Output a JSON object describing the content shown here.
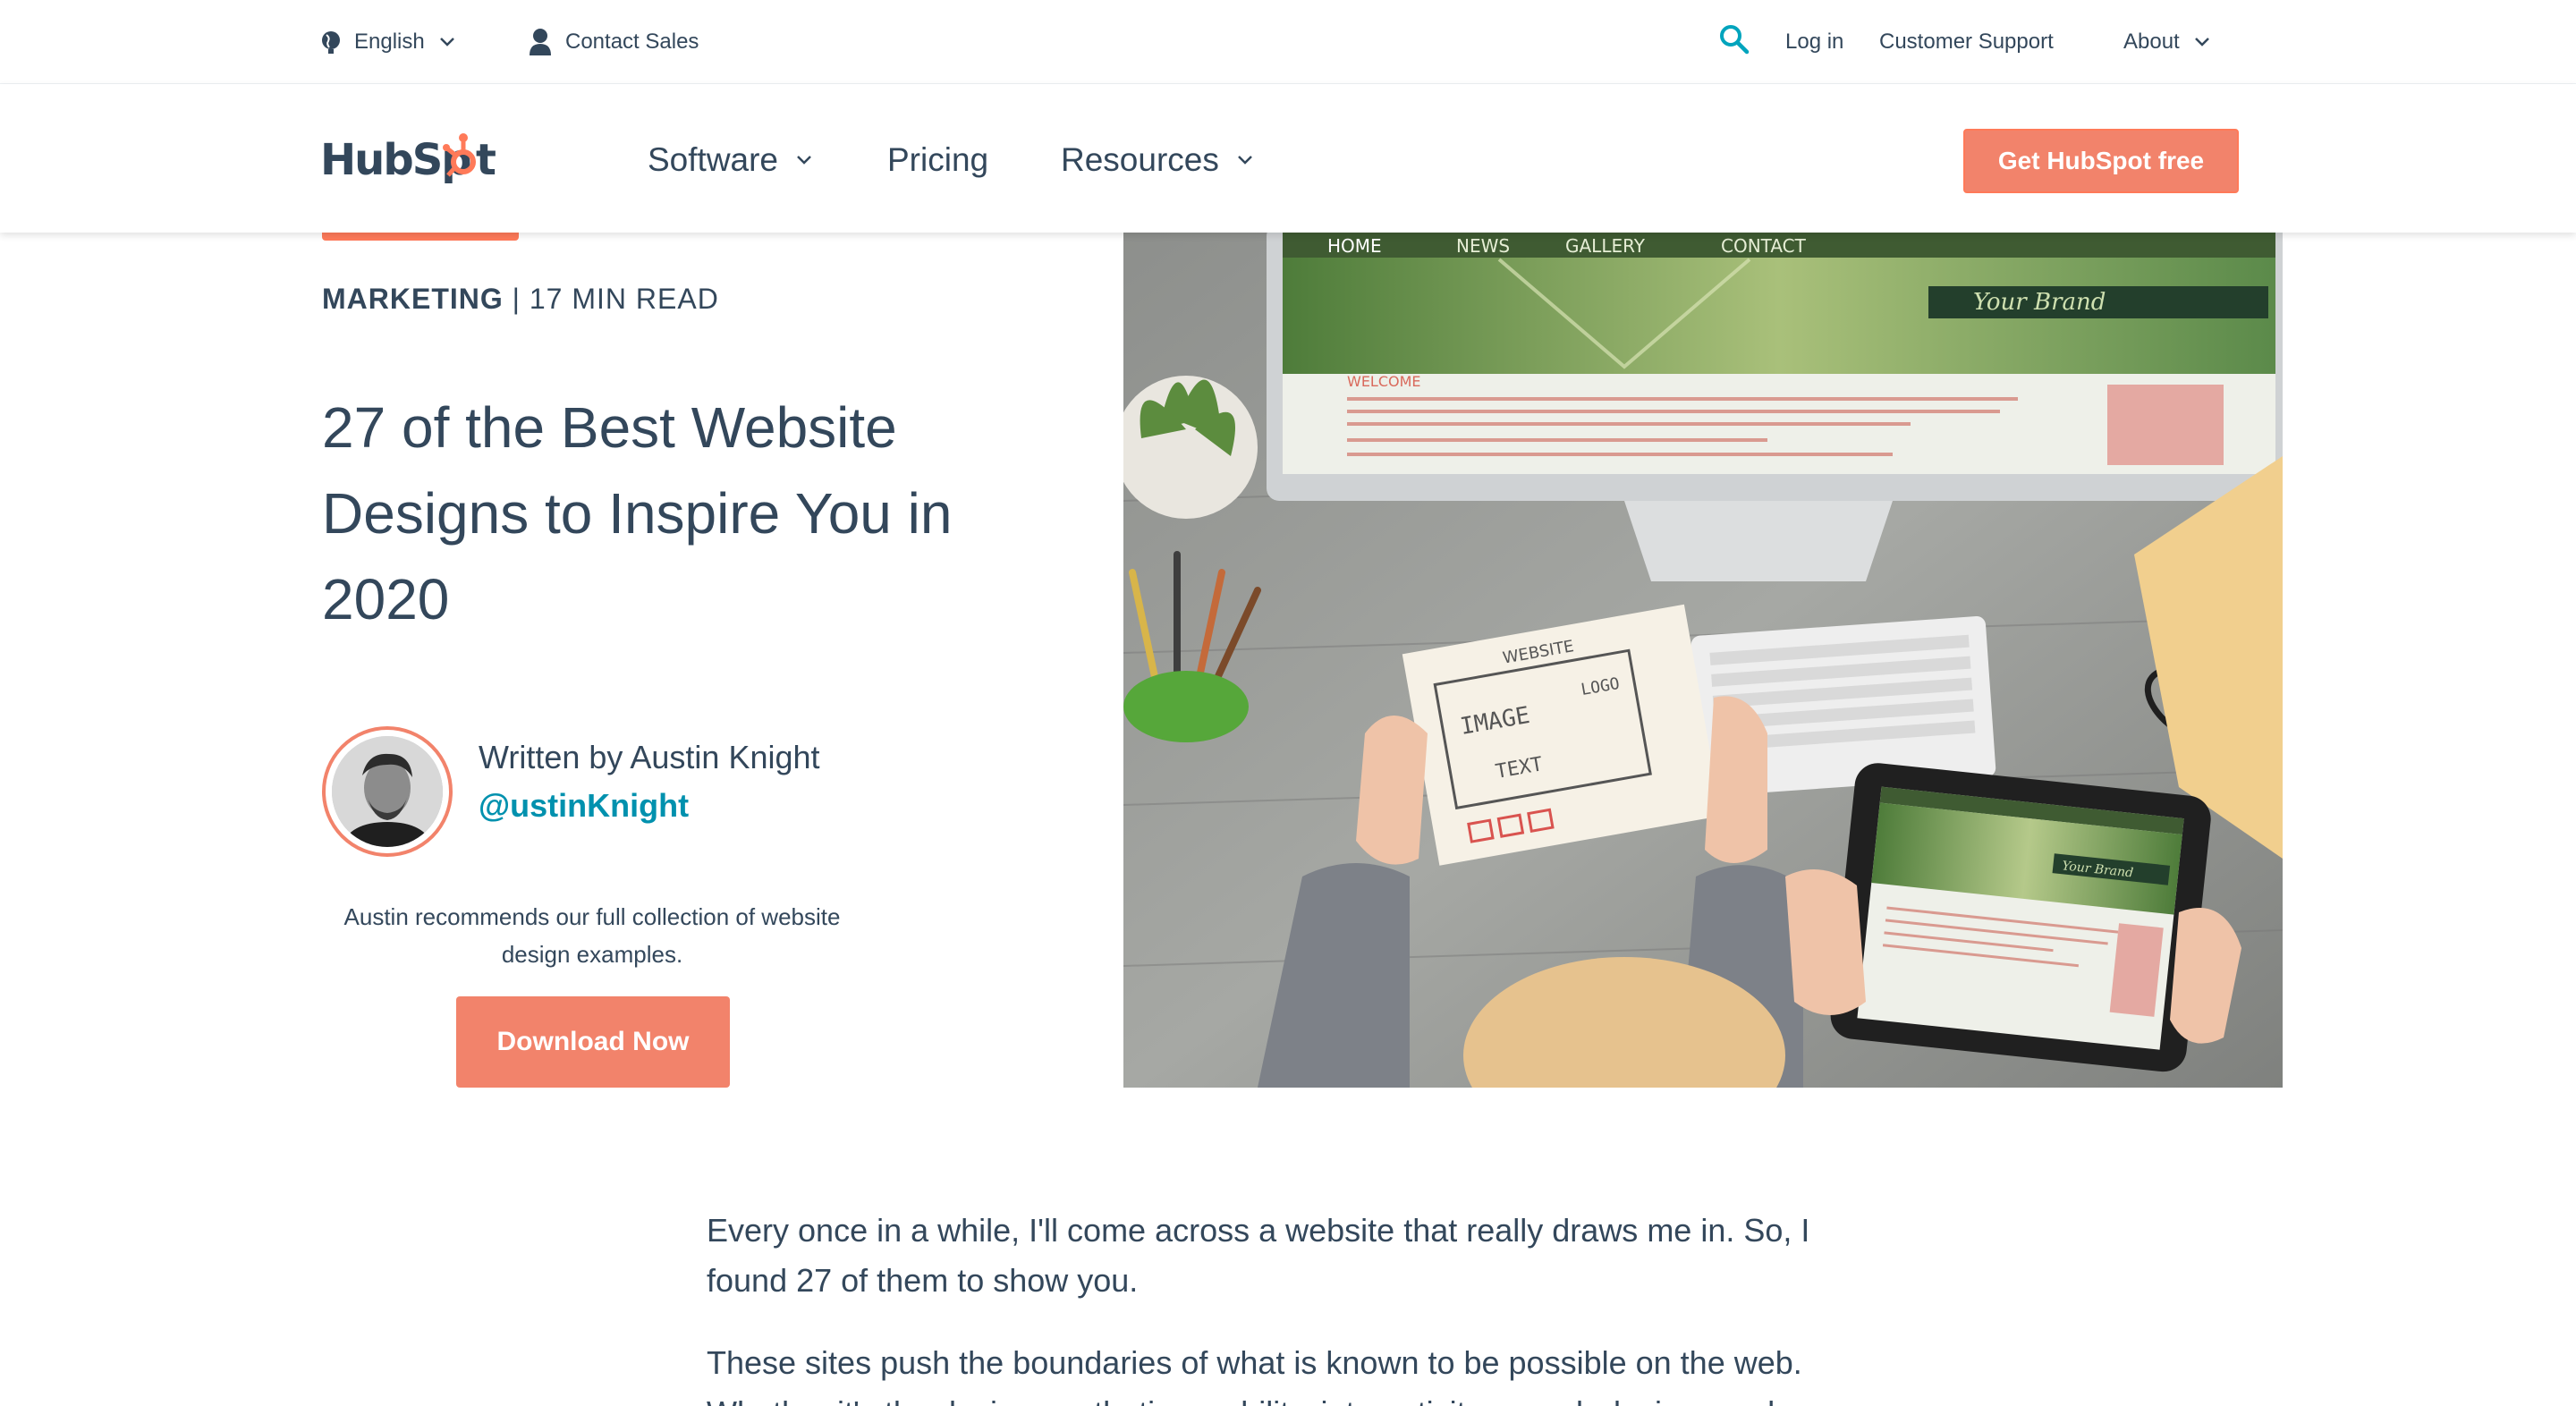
{
  "utility": {
    "language": "English",
    "contact_sales": "Contact Sales",
    "login": "Log in",
    "customer_support": "Customer Support",
    "about": "About"
  },
  "nav": {
    "logo": "HubSpot",
    "software": "Software",
    "pricing": "Pricing",
    "resources": "Resources",
    "cta": "Get HubSpot free"
  },
  "article": {
    "category": "MARKETING",
    "read_time": "| 17 MIN READ",
    "title": "27 of the Best Website Designs to Inspire You in 2020",
    "author_prefix": "Written by Austin Knight",
    "author_handle": "@ustinKnight",
    "recommendation": "Austin recommends our full collection of website design examples.",
    "download": "Download Now",
    "paragraph1": "Every once in a while, I'll come across a website that really draws me in. So, I found 27 of them to show you.",
    "paragraph2": "These sites push the boundaries of what is known to be possible on the web.",
    "paragraph3": "Whether it's the design aesthetic, usability, interactivity, or web design, each"
  },
  "hero_image": {
    "nav_home": "HOME",
    "nav_news": "NEWS",
    "nav_gallery": "GALLERY",
    "nav_contact": "CONTACT",
    "brand": "Your Brand",
    "welcome": "WELCOME",
    "sketch_website": "WEBSITE",
    "sketch_image": "IMAGE",
    "sketch_logo": "LOGO",
    "sketch_text": "TEXT",
    "tablet_brand": "Your Brand"
  },
  "colors": {
    "accent": "#ff7a59",
    "button": "#f2836b",
    "link": "#0091ae",
    "text": "#33475b"
  }
}
